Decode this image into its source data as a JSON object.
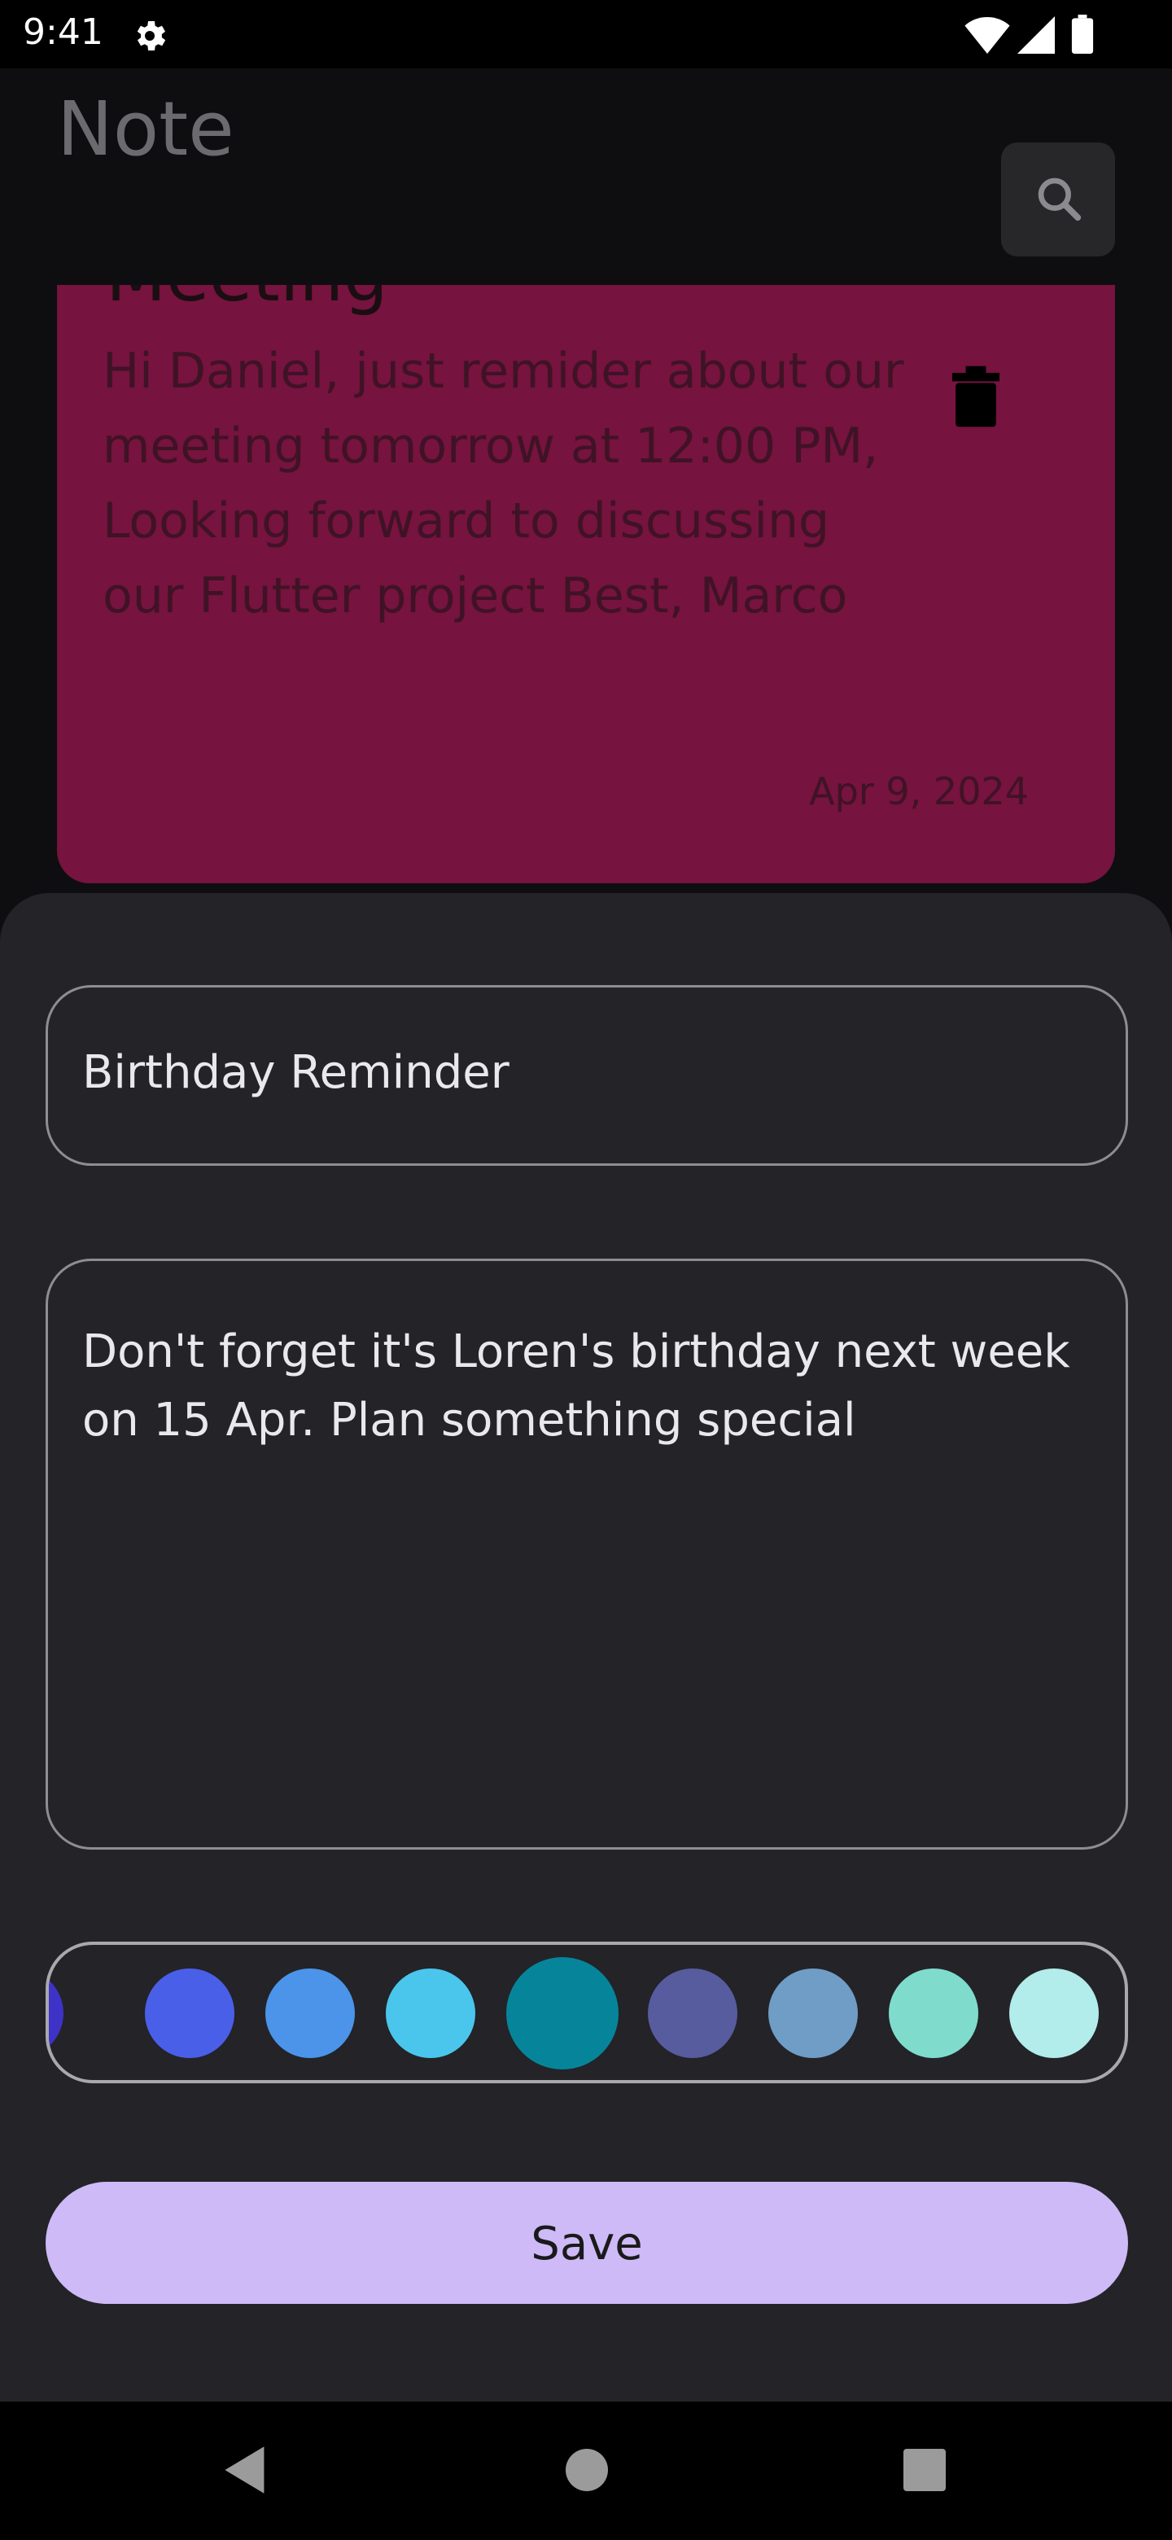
{
  "status_bar": {
    "time": "9:41"
  },
  "app_bar": {
    "title": "Note"
  },
  "note_card": {
    "title": "Meeting",
    "body": "Hi Daniel, just remider about our meeting tomorrow at 12:00 PM, Looking forward to discussing our Flutter project Best, Marco",
    "date": "Apr 9, 2024",
    "color": "#76133e"
  },
  "editor": {
    "title_value": "Birthday Reminder",
    "content_value": "Don't forget it's Loren's birthday next week on 15 Apr. Plan something special",
    "colors": [
      "#3e33c6",
      "#4a5fe8",
      "#4b94ea",
      "#4ac6ec",
      "#06859a",
      "#575c9e",
      "#6f9dc6",
      "#7fdccd",
      "#b2eceb"
    ],
    "selected_color": "#06859a",
    "save_label": "Save"
  },
  "theme": {
    "accent": "#cdbaf7",
    "sheet": "#232328"
  }
}
